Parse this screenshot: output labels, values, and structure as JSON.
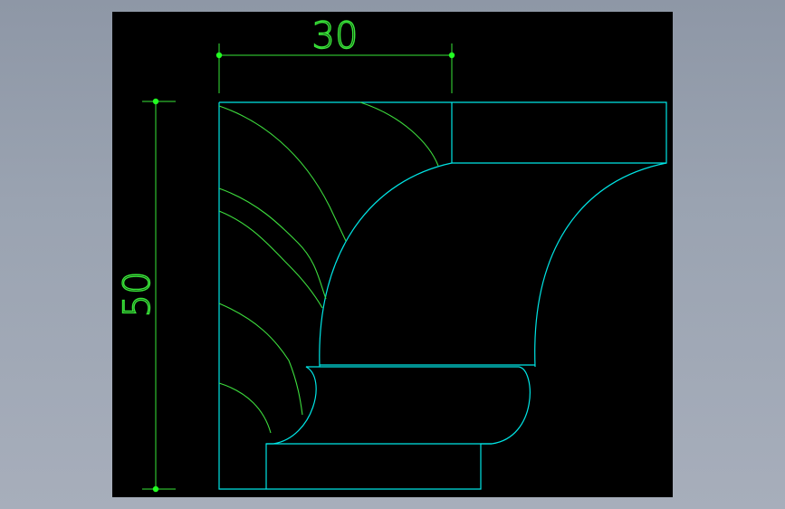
{
  "drawing": {
    "dimensions": {
      "width_value": "30",
      "height_value": "50"
    },
    "colors": {
      "background": "#000000",
      "outline": "#00e5e5",
      "carving": "#3ddc3d",
      "dimension": "#39e639",
      "grip": "#22ff22"
    }
  }
}
